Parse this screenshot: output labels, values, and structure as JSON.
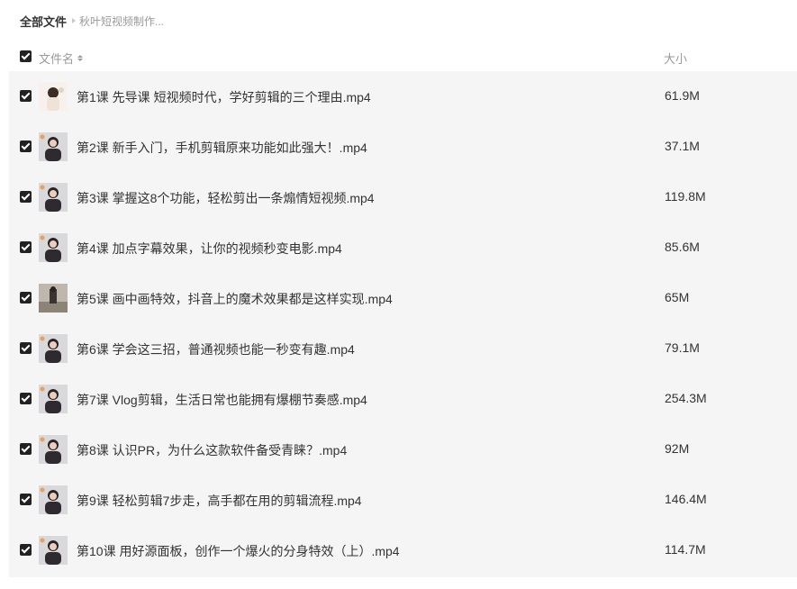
{
  "breadcrumb": {
    "root": "全部文件",
    "current": "秋叶短视频制作..."
  },
  "columns": {
    "name": "文件名",
    "size": "大小"
  },
  "files": [
    {
      "name": "第1课 先导课 短视频时代，学好剪辑的三个理由.mp4",
      "size": "61.9M",
      "thumb": "light"
    },
    {
      "name": "第2课 新手入门，手机剪辑原来功能如此强大！.mp4",
      "size": "37.1M",
      "thumb": "dark"
    },
    {
      "name": "第3课 掌握这8个功能，轻松剪出一条煽情短视频.mp4",
      "size": "119.8M",
      "thumb": "dark"
    },
    {
      "name": "第4课 加点字幕效果，让你的视频秒变电影.mp4",
      "size": "85.6M",
      "thumb": "dark"
    },
    {
      "name": "第5课 画中画特效，抖音上的魔术效果都是这样实现.mp4",
      "size": "65M",
      "thumb": "street"
    },
    {
      "name": "第6课 学会这三招，普通视频也能一秒变有趣.mp4",
      "size": "79.1M",
      "thumb": "dark"
    },
    {
      "name": "第7课 Vlog剪辑，生活日常也能拥有爆棚节奏感.mp4",
      "size": "254.3M",
      "thumb": "dark"
    },
    {
      "name": "第8课 认识PR，为什么这款软件备受青睐？.mp4",
      "size": "92M",
      "thumb": "dark"
    },
    {
      "name": "第9课 轻松剪辑7步走，高手都在用的剪辑流程.mp4",
      "size": "146.4M",
      "thumb": "dark"
    },
    {
      "name": "第10课 用好源面板，创作一个爆火的分身特效（上）.mp4",
      "size": "114.7M",
      "thumb": "dark"
    }
  ]
}
